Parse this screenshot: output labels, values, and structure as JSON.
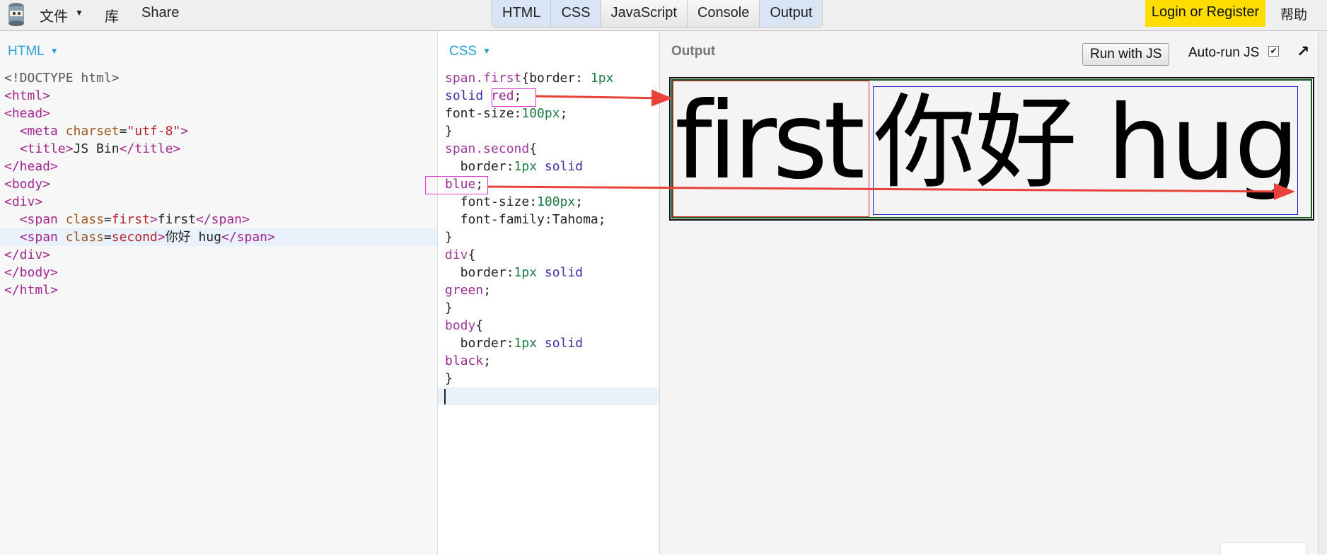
{
  "menu": {
    "file": "文件",
    "library": "库",
    "share": "Share"
  },
  "tabs": [
    "HTML",
    "CSS",
    "JavaScript",
    "Console",
    "Output"
  ],
  "login": "Login or Register",
  "help": "帮助",
  "html_panel": {
    "label": "HTML"
  },
  "css_panel": {
    "label": "CSS"
  },
  "output": {
    "label": "Output",
    "run": "Run with JS",
    "autorun": "Auto-run JS",
    "first_text": "first",
    "second_text": "你好 hug"
  },
  "html_code": [
    [
      [
        "t-doc",
        "<!DOCTYPE html>"
      ]
    ],
    [
      [
        "t-tag",
        "<html>"
      ]
    ],
    [
      [
        "t-tag",
        "<head>"
      ]
    ],
    [
      [
        "t-text",
        "  "
      ],
      [
        "t-tag",
        "<meta "
      ],
      [
        "t-attr",
        "charset"
      ],
      [
        "t-text",
        "="
      ],
      [
        "t-str",
        "\"utf-8\""
      ],
      [
        "t-tag",
        ">"
      ]
    ],
    [
      [
        "t-text",
        "  "
      ],
      [
        "t-tag",
        "<title>"
      ],
      [
        "t-text",
        "JS Bin"
      ],
      [
        "t-tag",
        "</title>"
      ]
    ],
    [
      [
        "t-tag",
        "</head>"
      ]
    ],
    [
      [
        "t-tag",
        "<body>"
      ]
    ],
    [
      [
        "t-tag",
        "<div>"
      ]
    ],
    [
      [
        "t-text",
        "  "
      ],
      [
        "t-tag",
        "<span "
      ],
      [
        "t-attr",
        "class"
      ],
      [
        "t-text",
        "="
      ],
      [
        "t-str",
        "first"
      ],
      [
        "t-tag",
        ">"
      ],
      [
        "t-text",
        "first"
      ],
      [
        "t-tag",
        "</span>"
      ]
    ],
    [
      [
        "t-text",
        "  "
      ],
      [
        "t-tag",
        "<span "
      ],
      [
        "t-attr",
        "class"
      ],
      [
        "t-text",
        "="
      ],
      [
        "t-str",
        "second"
      ],
      [
        "t-tag",
        ">"
      ],
      [
        "t-text",
        "你好 hug"
      ],
      [
        "t-tag",
        "</span>"
      ]
    ],
    [
      [
        "t-tag",
        "</div>"
      ]
    ],
    [
      [
        "t-tag",
        "</body>"
      ]
    ],
    [
      [
        "t-tag",
        "</html>"
      ]
    ]
  ],
  "css_code": [
    [
      [
        "t-sel",
        "span.first"
      ],
      [
        "t-prop",
        "{border: "
      ],
      [
        "t-num",
        "1px"
      ]
    ],
    [
      [
        "t-kw",
        "solid"
      ],
      [
        "t-prop",
        " "
      ],
      [
        "t-col",
        "red"
      ],
      [
        "t-prop",
        ";"
      ]
    ],
    [
      [
        "t-prop",
        "font-size:"
      ],
      [
        "t-num",
        "100px"
      ],
      [
        "t-prop",
        ";"
      ]
    ],
    [
      [
        "t-prop",
        "}"
      ]
    ],
    [
      [
        "t-sel",
        "span.second"
      ],
      [
        "t-prop",
        "{"
      ]
    ],
    [
      [
        "t-prop",
        "  border:"
      ],
      [
        "t-num",
        "1px "
      ],
      [
        "t-kw",
        "solid"
      ]
    ],
    [
      [
        "t-col",
        "blue"
      ],
      [
        "t-prop",
        ";"
      ]
    ],
    [
      [
        "t-prop",
        "  font-size:"
      ],
      [
        "t-num",
        "100px"
      ],
      [
        "t-prop",
        ";"
      ]
    ],
    [
      [
        "t-prop",
        "  font-family:Tahoma;"
      ]
    ],
    [
      [
        "t-prop",
        "}"
      ]
    ],
    [
      [
        "t-sel",
        "div"
      ],
      [
        "t-prop",
        "{"
      ]
    ],
    [
      [
        "t-prop",
        "  border:"
      ],
      [
        "t-num",
        "1px "
      ],
      [
        "t-kw",
        "solid"
      ]
    ],
    [
      [
        "t-col",
        "green"
      ],
      [
        "t-prop",
        ";"
      ]
    ],
    [
      [
        "t-prop",
        "}"
      ]
    ],
    [
      [
        "t-sel",
        "body"
      ],
      [
        "t-prop",
        "{"
      ]
    ],
    [
      [
        "t-prop",
        "  border:"
      ],
      [
        "t-num",
        "1px "
      ],
      [
        "t-kw",
        "solid"
      ]
    ],
    [
      [
        "t-col",
        "black"
      ],
      [
        "t-prop",
        ";"
      ]
    ],
    [
      [
        "t-prop",
        "}"
      ]
    ]
  ],
  "colors": {
    "annotation_box": "#e03cd5",
    "arrow": "#e8423a",
    "login_bg": "#ffdd00",
    "panel_label": "#2a9fd8"
  }
}
